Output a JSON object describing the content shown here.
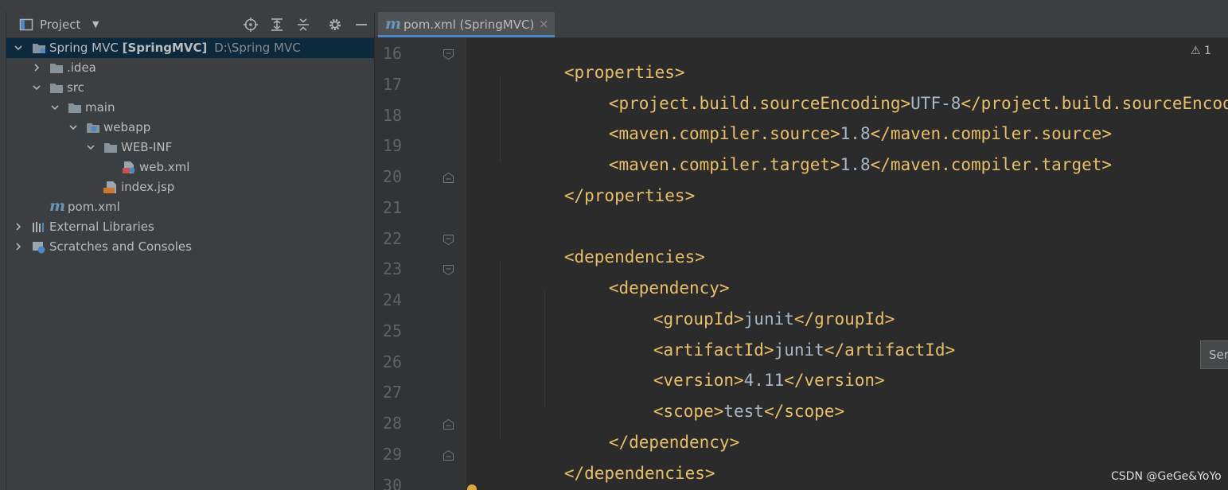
{
  "project_panel": {
    "title": "Project",
    "tree": [
      {
        "label": "Spring MVC",
        "bold": "[SpringMVC]",
        "path": "D:\\Spring MVC"
      },
      {
        "label": ".idea"
      },
      {
        "label": "src"
      },
      {
        "label": "main"
      },
      {
        "label": "webapp"
      },
      {
        "label": "WEB-INF"
      },
      {
        "label": "web.xml"
      },
      {
        "label": "index.jsp"
      },
      {
        "label": "pom.xml"
      },
      {
        "label": "External Libraries"
      },
      {
        "label": "Scratches and Consoles"
      }
    ]
  },
  "editor": {
    "tab": {
      "icon_text": "m",
      "label": "pom.xml (SpringMVC)",
      "close": "×"
    },
    "warning_count": "1",
    "side_button": "Ser",
    "lines": [
      {
        "num": "16",
        "tag1": "<properties>",
        "text": "",
        "tag2": ""
      },
      {
        "num": "17",
        "tag1": "<project.build.sourceEncoding>",
        "text": "UTF-8",
        "tag2": "</project.build.sourceEncoding>"
      },
      {
        "num": "18",
        "tag1": "<maven.compiler.source>",
        "text": "1.8",
        "tag2": "</maven.compiler.source>"
      },
      {
        "num": "19",
        "tag1": "<maven.compiler.target>",
        "text": "1.8",
        "tag2": "</maven.compiler.target>"
      },
      {
        "num": "20",
        "tag1": "</properties>",
        "text": "",
        "tag2": ""
      },
      {
        "num": "21",
        "tag1": "",
        "text": "",
        "tag2": ""
      },
      {
        "num": "22",
        "tag1": "<dependencies>",
        "text": "",
        "tag2": ""
      },
      {
        "num": "23",
        "tag1": "<dependency>",
        "text": "",
        "tag2": ""
      },
      {
        "num": "24",
        "tag1": "<groupId>",
        "text": "junit",
        "tag2": "</groupId>"
      },
      {
        "num": "25",
        "tag1": "<artifactId>",
        "text": "junit",
        "tag2": "</artifactId>"
      },
      {
        "num": "26",
        "tag1": "<version>",
        "text": "4.11",
        "tag2": "</version>"
      },
      {
        "num": "27",
        "tag1": "<scope>",
        "text": "test",
        "tag2": "</scope>"
      },
      {
        "num": "28",
        "tag1": "</dependency>",
        "text": "",
        "tag2": ""
      },
      {
        "num": "29",
        "tag1": "</dependencies>",
        "text": "",
        "tag2": ""
      },
      {
        "num": "30",
        "tag1": "",
        "text": "",
        "tag2": ""
      }
    ]
  },
  "watermark": "CSDN @GeGe&YoYo",
  "colors": {
    "tag": "#e8bf6a",
    "text": "#a9b7c6",
    "background": "#2b2b2b",
    "panel": "#3c3f41",
    "selection": "#0d293e"
  }
}
